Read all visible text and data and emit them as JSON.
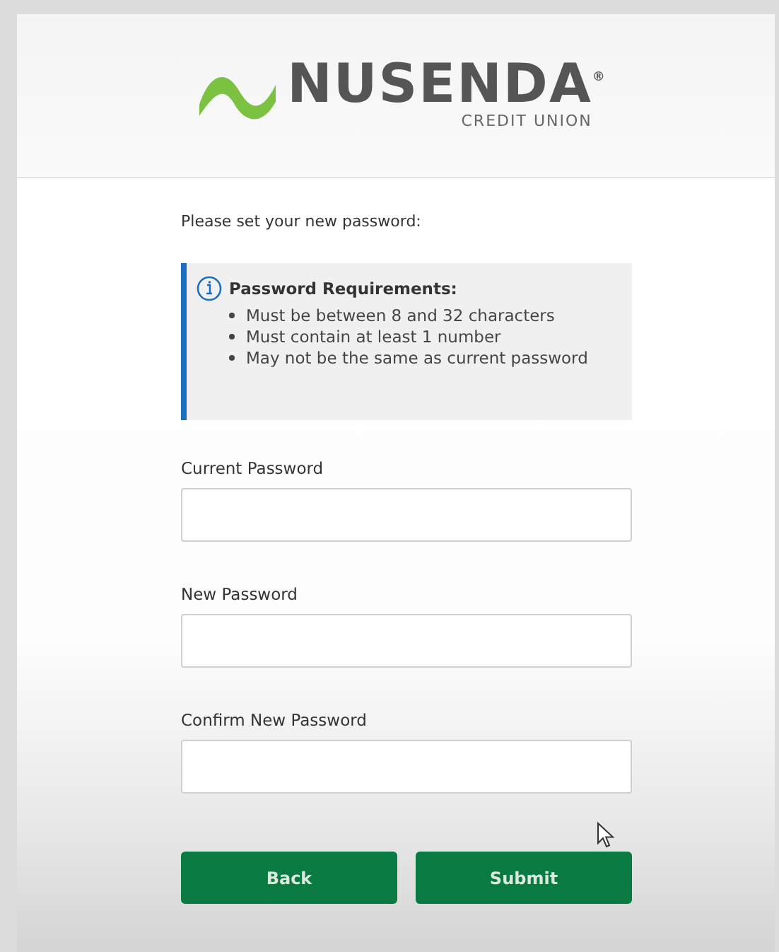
{
  "logo": {
    "wordmark": "NUSENDA$^{®}$",
    "tagline": "CREDIT UNION"
  },
  "intro": "Please set your new password:",
  "requirements": {
    "title": "Password Requirements:",
    "items": [
      "Must be between 8 and 32 characters",
      "Must contain at least 1 number",
      "May not be the same as current password"
    ]
  },
  "fields": [
    {
      "label": "Current Password"
    },
    {
      "label": "New Password"
    },
    {
      "label": "Confirm New Password"
    }
  ],
  "buttons": [
    "Back",
    "Submit"
  ]
}
